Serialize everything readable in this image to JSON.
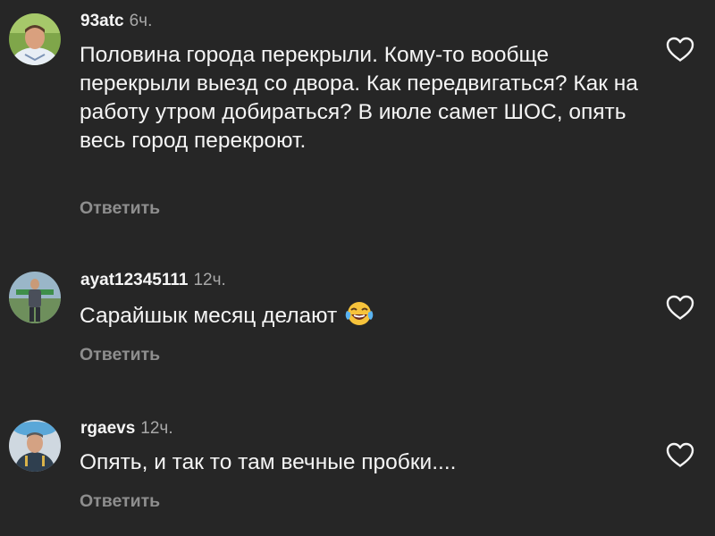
{
  "comments": [
    {
      "username": "93atc",
      "time": "6ч.",
      "text": "Половина города перекрыли. Кому-то вообще перекрыли выезд со двора.  Как передвигаться? Как на работу утром добираться? В июле самет ШОС, опять весь город перекроют.",
      "reply_label": "Ответить"
    },
    {
      "username": "ayat12345111",
      "time": "12ч.",
      "text": "Сарайшык месяц делают",
      "emoji": "face-with-tears-of-joy-icon",
      "reply_label": "Ответить"
    },
    {
      "username": "rgaevs",
      "time": "12ч.",
      "text": "Опять, и так то там вечные пробки....",
      "reply_label": "Ответить"
    }
  ],
  "icons": {
    "like": "heart-outline-icon"
  },
  "colors": {
    "background": "#262626",
    "text": "#f5f5f5",
    "secondary": "#a8a8a8",
    "reply": "#8e8e8e"
  }
}
